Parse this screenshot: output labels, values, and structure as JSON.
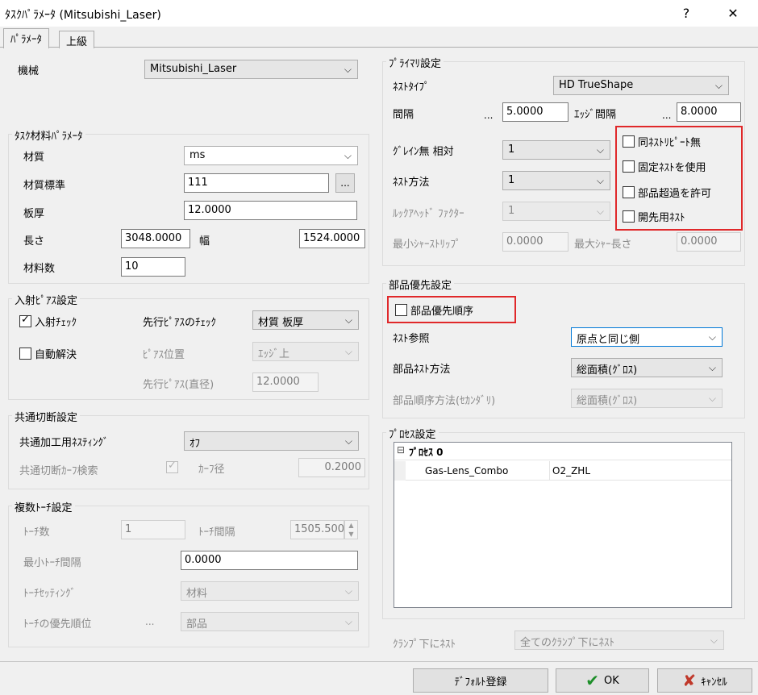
{
  "window": {
    "title": "ﾀｽｸﾊﾟﾗﾒｰﾀ (Mitsubishi_Laser)",
    "help_label": "?",
    "close_label": "✕"
  },
  "tabs": [
    "ﾊﾟﾗﾒｰﾀ",
    "上級"
  ],
  "machine": {
    "label": "機械",
    "value": "Mitsubishi_Laser"
  },
  "task_material": {
    "title": "ﾀｽｸ材料ﾊﾟﾗﾒｰﾀ",
    "material_label": "材質",
    "material_value": "ms",
    "standard_label": "材質標準",
    "standard_value": "111",
    "standard_button": "...",
    "thickness_label": "板厚",
    "thickness_value": "12.0000",
    "length_label": "長さ",
    "length_value": "3048.0000",
    "width_label": "幅",
    "width_value": "1524.0000",
    "count_label": "材料数",
    "count_value": "10"
  },
  "pierce": {
    "title": "入射ﾋﾟｱｽ設定",
    "check_label": "入射ﾁｪｯｸ",
    "check_checked": true,
    "auto_label": "自動解決",
    "auto_checked": false,
    "pre_check_label": "先行ﾋﾟｱｽのﾁｪｯｸ",
    "pre_check_value": "材質 板厚",
    "position_label": "ﾋﾟｱｽ位置",
    "position_value": "ｴｯｼﾞ上",
    "diameter_label": "先行ﾋﾟｱｽ(直径)",
    "diameter_value": "12.0000"
  },
  "common_cut": {
    "title": "共通切断設定",
    "nesting_label": "共通加工用ﾈｽﾃｨﾝｸﾞ",
    "nesting_value": "ｵﾌ",
    "kerf_search_label": "共通切断ｶｰﾌ検索",
    "kerf_label": "ｶｰﾌ径",
    "kerf_value": "0.2000"
  },
  "multi_torch": {
    "title": "複数ﾄｰﾁ設定",
    "count_label": "ﾄｰﾁ数",
    "count_value": "1",
    "spacing_label": "ﾄｰﾁ間隔",
    "spacing_value": "1505.5000",
    "min_spacing_label": "最小ﾄｰﾁ間隔",
    "min_spacing_value": "0.0000",
    "setting_label": "ﾄｰﾁｾｯﾃｨﾝｸﾞ",
    "setting_value": "材料",
    "priority_label": "ﾄｰﾁの優先順位",
    "priority_ellipsis": "...",
    "priority_value": "部品"
  },
  "primary": {
    "title": "ﾌﾟﾗｲﾏﾘ設定",
    "nest_type_label": "ﾈｽﾄﾀｲﾌﾟ",
    "nest_type_value": "HD TrueShape",
    "spacing_label": "間隔",
    "spacing_ellipsis": "...",
    "spacing_value": "5.0000",
    "edge_spacing_label": "ｴｯｼﾞ間隔",
    "edge_ellipsis": "...",
    "edge_spacing_value": "8.0000",
    "grain_label": "ｸﾞﾚｲﾝ無 相対",
    "grain_value": "1",
    "nest_method_label": "ﾈｽﾄ方法",
    "nest_method_value": "1",
    "lookahead_label": "ﾙｯｸｱﾍｯﾄﾞ ﾌｧｸﾀｰ",
    "lookahead_value": "1",
    "min_shear_label": "最小ｼｬｰｽﾄﾘｯﾌﾟ",
    "min_shear_value": "0.0000",
    "max_shear_label": "最大ｼｬｰ長さ",
    "max_shear_value": "0.0000",
    "options": [
      {
        "label": "同ﾈｽﾄﾘﾋﾟｰﾄ無",
        "checked": false
      },
      {
        "label": "固定ﾈｽﾄを使用",
        "checked": false
      },
      {
        "label": "部品超過を許可",
        "checked": false
      },
      {
        "label": "開先用ﾈｽﾄ",
        "checked": false
      }
    ]
  },
  "part_priority": {
    "title": "部品優先設定",
    "order_label": "部品優先順序",
    "order_checked": false,
    "nest_ref_label": "ﾈｽﾄ参照",
    "nest_ref_value": "原点と同じ側",
    "part_nest_method_label": "部品ﾈｽﾄ方法",
    "part_nest_method_value": "総面積(ｸﾞﾛｽ)",
    "part_order_method_label": "部品順序方法(ｾｶﾝﾀﾞﾘ)",
    "part_order_method_value": "総面積(ｸﾞﾛｽ)"
  },
  "process": {
    "title": "ﾌﾟﾛｾｽ設定",
    "tree_root": "ﾌﾟﾛｾｽ 0",
    "tree_toggle": "⊟",
    "row_name": "Gas-Lens_Combo",
    "row_value": "O2_ZHL"
  },
  "clamp": {
    "label": "ｸﾗﾝﾌﾟ下にﾈｽﾄ",
    "value": "全てのｸﾗﾝﾌﾟ下にﾈｽﾄ"
  },
  "buttons": {
    "default": "ﾃﾞﾌｫﾙﾄ登録",
    "ok": "OK",
    "cancel": "ｷｬﾝｾﾙ"
  },
  "colors": {
    "highlight_border": "#e0282a",
    "focus_border": "#0078d7",
    "ok_check": "#1e8f2a",
    "cancel_x": "#c0392b"
  },
  "icons": {
    "checkmark": "checkmark-icon",
    "chevron": "chevron-down-icon",
    "ok": "ok-check-icon",
    "cancel": "cancel-x-icon",
    "spin": "spinner-arrows-icon"
  }
}
